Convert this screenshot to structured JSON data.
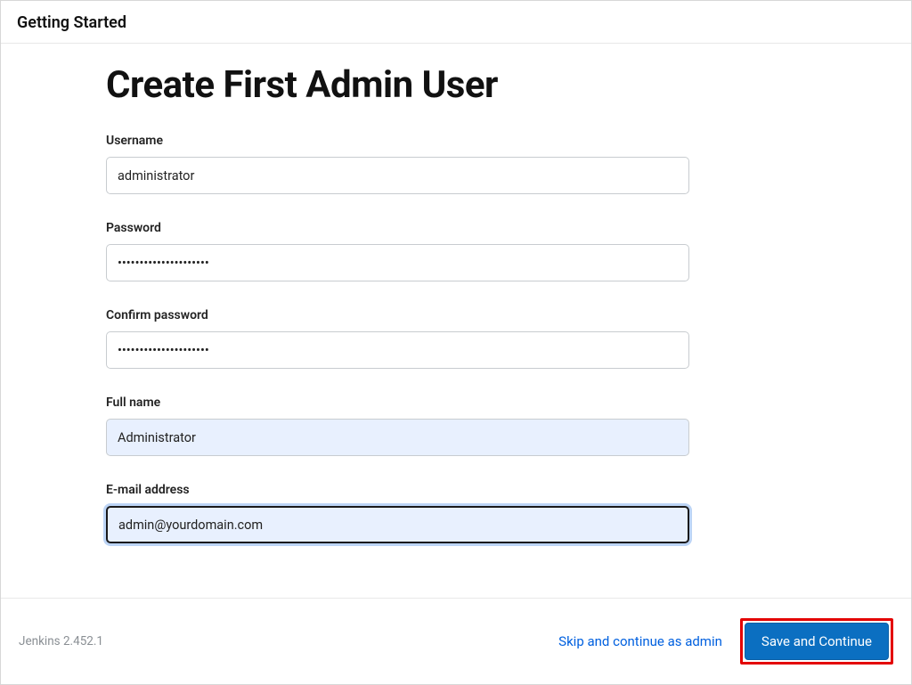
{
  "header": {
    "title": "Getting Started"
  },
  "main": {
    "heading": "Create First Admin User",
    "fields": {
      "username": {
        "label": "Username",
        "value": "administrator"
      },
      "password": {
        "label": "Password",
        "value": "•••••••••••••••••••••"
      },
      "confirm": {
        "label": "Confirm password",
        "value": "•••••••••••••••••••••"
      },
      "fullname": {
        "label": "Full name",
        "value": "Administrator"
      },
      "email": {
        "label": "E-mail address",
        "value": "admin@yourdomain.com"
      }
    }
  },
  "footer": {
    "version": "Jenkins 2.452.1",
    "skip_label": "Skip and continue as admin",
    "save_label": "Save and Continue"
  }
}
